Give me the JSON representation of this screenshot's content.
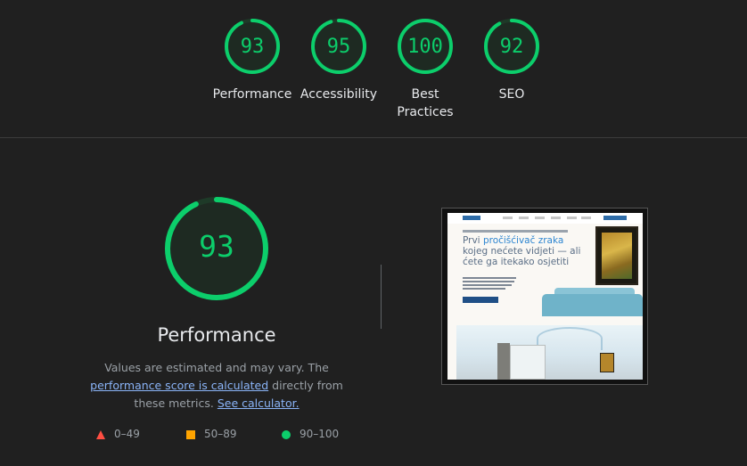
{
  "categories": [
    {
      "label": "Performance",
      "score": "93",
      "value": 93
    },
    {
      "label": "Accessibility",
      "score": "95",
      "value": 95
    },
    {
      "label": "Best Practices",
      "score": "100",
      "value": 100
    },
    {
      "label": "SEO",
      "score": "92",
      "value": 92
    }
  ],
  "main": {
    "score": "93",
    "value": 93,
    "title": "Performance",
    "desc_prefix": "Values are estimated and may vary. The ",
    "desc_link1": "performance score is calculated",
    "desc_middle": " directly from these metrics. ",
    "desc_link2": "See calculator."
  },
  "legend": [
    {
      "icon": "red-triangle-icon",
      "label": "0–49",
      "color": "#ff4e42"
    },
    {
      "icon": "orange-square-icon",
      "label": "50–89",
      "color": "#ffa400"
    },
    {
      "icon": "green-circle-icon",
      "label": "90–100",
      "color": "#0cce6b"
    }
  ],
  "colors": {
    "pass": "#0cce6b",
    "average": "#ffa400",
    "fail": "#ff4e42",
    "link": "#8ab4f8"
  },
  "screenshot": {
    "headline_pre": "Prvi ",
    "headline_accent": "pročišćivač zraka",
    "headline_post": " kojeg nećete vidjeti — ali ćete ga itekako osjetiti"
  }
}
